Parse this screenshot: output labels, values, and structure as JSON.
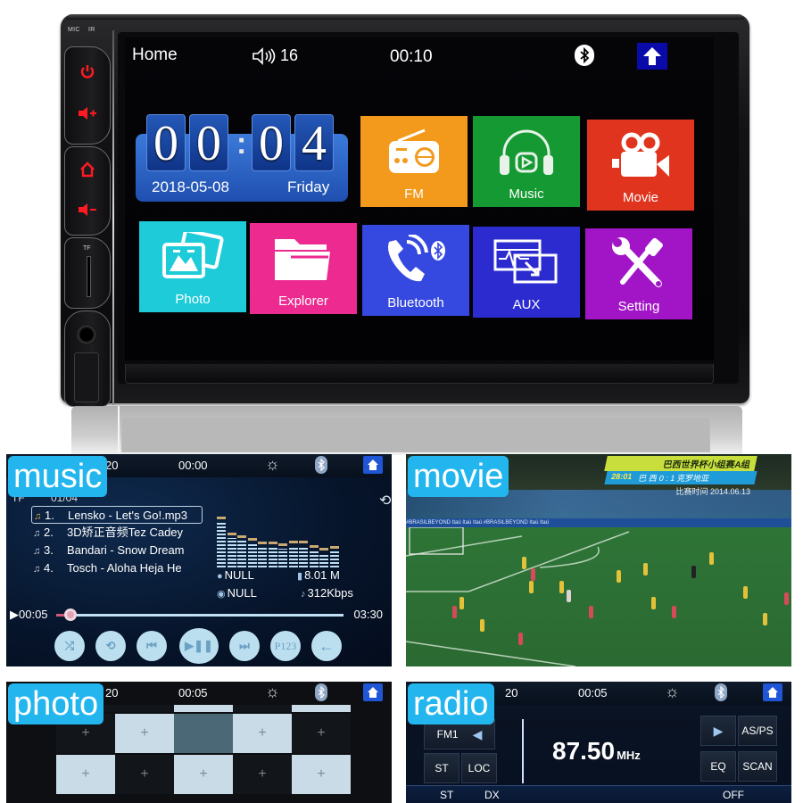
{
  "device": {
    "mic_label": "MIC",
    "ir_label": "IR",
    "tf_label": "TF",
    "hardware_buttons": [
      {
        "name": "power",
        "glyph": "⏻"
      },
      {
        "name": "volume-up",
        "glyph": "🔈+"
      },
      {
        "name": "home",
        "glyph": "⌂"
      },
      {
        "name": "volume-down",
        "glyph": "🔈-"
      }
    ]
  },
  "home_screen": {
    "status_bar": {
      "title": "Home",
      "volume": "16",
      "clock": "00:10",
      "bluetooth_icon": "bluetooth-icon",
      "home_icon": "home-up-arrow-icon"
    },
    "clock_widget": {
      "digits": [
        "0",
        "0",
        "0",
        "4"
      ],
      "separator": ":",
      "date": "2018-05-08",
      "day": "Friday"
    },
    "tiles": [
      {
        "id": "fm",
        "label": "FM",
        "icon": "radio-icon",
        "color": "#f39a1c"
      },
      {
        "id": "music",
        "label": "Music",
        "icon": "headphones-icon",
        "color": "#159a33"
      },
      {
        "id": "movie",
        "label": "Movie",
        "icon": "video-camera-icon",
        "color": "#e0341f"
      },
      {
        "id": "photo",
        "label": "Photo",
        "icon": "photo-icon",
        "color": "#1ecbd9"
      },
      {
        "id": "explorer",
        "label": "Explorer",
        "icon": "folder-icon",
        "color": "#ec2a8f"
      },
      {
        "id": "bluetooth",
        "label": "Bluetooth",
        "icon": "bluetooth-phone-icon",
        "color": "#3548e0"
      },
      {
        "id": "aux",
        "label": "AUX",
        "icon": "aux-icon",
        "color": "#2b2bd0"
      },
      {
        "id": "setting",
        "label": "Setting",
        "icon": "wrench-screwdriver-icon",
        "color": "#a215c6"
      }
    ]
  },
  "music_panel": {
    "tag": "music",
    "status_left": "20",
    "clock": "00:00",
    "source": "TF",
    "track_count": "01/04",
    "tracks": [
      {
        "num": "1.",
        "title": "Lensko - Let's Go!.mp3",
        "active": true
      },
      {
        "num": "2.",
        "title": "3D矫正音频Tez Cadey",
        "active": false
      },
      {
        "num": "3.",
        "title": "Bandari - Snow Dream",
        "active": false
      },
      {
        "num": "4.",
        "title": "Tosch - Aloha Heja He",
        "active": false
      }
    ],
    "spectrum_levels": [
      0.95,
      0.62,
      0.55,
      0.5,
      0.42,
      0.42,
      0.38,
      0.45,
      0.44,
      0.36,
      0.3,
      0.34
    ],
    "artist": "NULL",
    "album": "NULL",
    "file_size": "8.01 M",
    "bitrate": "312Kbps",
    "elapsed": "00:05",
    "duration": "03:30",
    "progress": 0.024,
    "controls": [
      {
        "name": "shuffle",
        "glyph": "⤮"
      },
      {
        "name": "repeat",
        "glyph": "⟲"
      },
      {
        "name": "previous",
        "glyph": "⏮"
      },
      {
        "name": "play-pause",
        "glyph": "▶❚❚"
      },
      {
        "name": "next",
        "glyph": "⏭"
      },
      {
        "name": "preset",
        "glyph": "P123"
      },
      {
        "name": "back",
        "glyph": "←"
      }
    ]
  },
  "movie_panel": {
    "tag": "movie",
    "score_title": "巴西世界杯小组赛A组",
    "score_time": "28:01",
    "score_line": "巴 西  0 : 1  克罗地亚",
    "match_date": "比赛时间 2014.06.13",
    "ad_text": "#BRASILBEYOND  Itaú  Itaú  Itaú  #BRASILBEYOND  Itaú  Itaú"
  },
  "photo_panel": {
    "tag": "photo",
    "status_left": "20",
    "clock": "00:05",
    "thumbnail_glyph": "+"
  },
  "radio_panel": {
    "tag": "radio",
    "status_left": "20",
    "clock": "00:05",
    "band": "FM1",
    "frequency": "87.50",
    "unit": "MHz",
    "buttons": {
      "st": "ST",
      "loc": "LOC",
      "as_ps": "AS/PS",
      "eq": "EQ",
      "scan": "SCAN"
    },
    "bottom": {
      "st": "ST",
      "dx": "DX",
      "eq_mode": "OFF"
    }
  }
}
